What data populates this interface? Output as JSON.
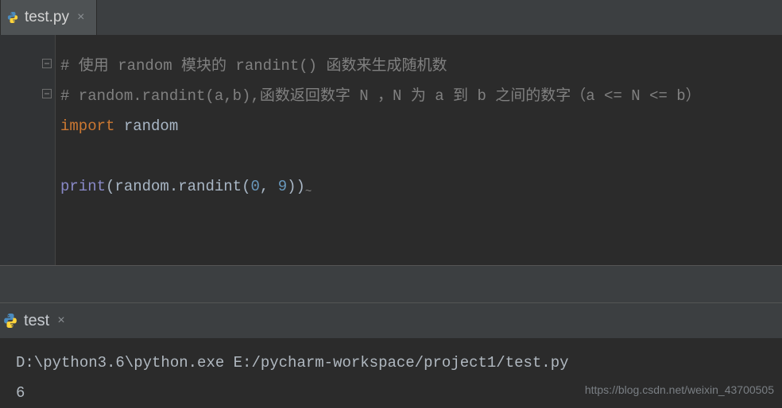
{
  "editor": {
    "tab": {
      "filename": "test.py",
      "close_glyph": "×"
    },
    "code": {
      "line1_comment": "# 使用 random 模块的 randint() 函数来生成随机数",
      "line2_comment": "# random.randint(a,b),函数返回数字 N ，N 为 a 到 b 之间的数字（a <= N <= b）",
      "import_kw": "import",
      "import_mod": "random",
      "print_fn": "print",
      "rand_call_obj": "random",
      "rand_call_method": "randint",
      "arg0": "0",
      "arg_sep": ", ",
      "arg1": "9"
    }
  },
  "run": {
    "tab": {
      "name": "test",
      "close_glyph": "×"
    },
    "console": {
      "command": "D:\\python3.6\\python.exe E:/pycharm-workspace/project1/test.py",
      "output": "6"
    }
  },
  "watermark": "https://blog.csdn.net/weixin_43700505"
}
